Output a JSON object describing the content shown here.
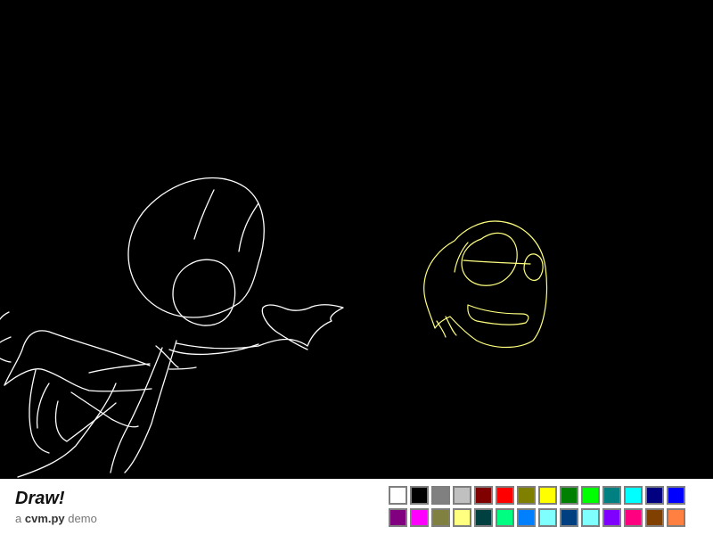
{
  "app": {
    "title": "Draw!",
    "subtitle_prefix": "a",
    "subtitle_name": "cvm.py",
    "subtitle_suffix": "demo"
  },
  "canvas": {
    "background": "#000000",
    "strokes": [
      {
        "name": "white-figure-strokes",
        "color": "#ffffff"
      },
      {
        "name": "yellow-face-strokes",
        "color": "#ffff80"
      }
    ]
  },
  "palette": {
    "colors": [
      "#ffffff",
      "#000000",
      "#808080",
      "#c0c0c0",
      "#800000",
      "#ff0000",
      "#808000",
      "#ffff00",
      "#008000",
      "#00ff00",
      "#008080",
      "#00ffff",
      "#000080",
      "#0000ff",
      "#800080",
      "#ff00ff",
      "#808040",
      "#ffff80",
      "#004040",
      "#00ff80",
      "#0080ff",
      "#80ffff",
      "#004080",
      "#80ffff",
      "#8000ff",
      "#ff0080",
      "#804000",
      "#ff8040"
    ]
  }
}
